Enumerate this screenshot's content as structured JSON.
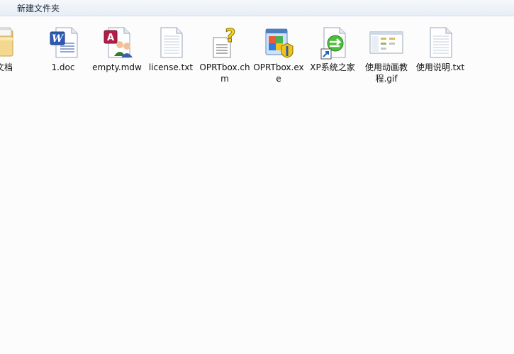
{
  "header": {
    "title": "新建文件夹"
  },
  "files": [
    {
      "name": "试文档",
      "icon": "folder-icon"
    },
    {
      "name": "1.doc",
      "icon": "word-document-icon"
    },
    {
      "name": "empty.mdw",
      "icon": "access-workgroup-icon"
    },
    {
      "name": "license.txt",
      "icon": "text-file-icon"
    },
    {
      "name": "OPRTbox.chm",
      "icon": "help-file-icon"
    },
    {
      "name": "OPRTbox.exe",
      "icon": "application-exe-icon"
    },
    {
      "name": "XP系统之家",
      "icon": "shortcut-globe-icon"
    },
    {
      "name": "使用动画教程.gif",
      "icon": "gif-image-icon"
    },
    {
      "name": "使用说明.txt",
      "icon": "text-file-icon"
    }
  ]
}
